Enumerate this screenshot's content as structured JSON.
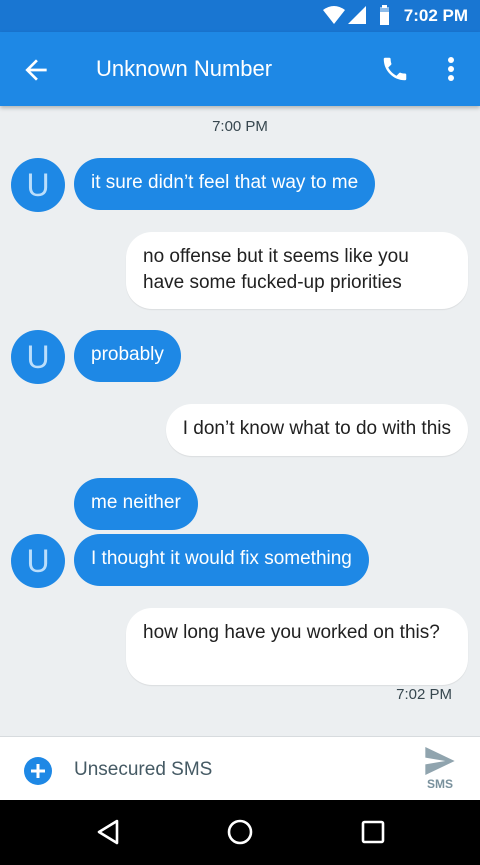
{
  "status": {
    "time": "7:02 PM"
  },
  "app_bar": {
    "title": "Unknown Number"
  },
  "conversation": {
    "top_timestamp": "7:00 PM",
    "bottom_timestamp": "7:02 PM",
    "avatar_letter": "U",
    "messages": [
      {
        "dir": "in",
        "text": "it sure didn’t feel that way to me"
      },
      {
        "dir": "out",
        "text": "no offense but it seems like you have some fucked-up priorities"
      },
      {
        "dir": "in",
        "text": "probably"
      },
      {
        "dir": "out",
        "text": "I don’t know what to do with this"
      },
      {
        "dir": "in",
        "text": "me neither"
      },
      {
        "dir": "in",
        "text": "I thought it would fix something"
      },
      {
        "dir": "out",
        "text": "how long have you worked on this?"
      }
    ]
  },
  "compose": {
    "placeholder": "Unsecured SMS",
    "send_label": "SMS"
  },
  "colors": {
    "status_bar": "#1976d2",
    "app_bar": "#1e88e5",
    "incoming_bubble": "#1e88e5",
    "outgoing_bubble": "#ffffff",
    "background": "#eceff1"
  },
  "icons": [
    "wifi-icon",
    "signal-icon",
    "battery-icon",
    "back-arrow-icon",
    "phone-icon",
    "more-vert-icon",
    "add-icon",
    "send-icon",
    "nav-back-icon",
    "nav-home-icon",
    "nav-recents-icon"
  ]
}
